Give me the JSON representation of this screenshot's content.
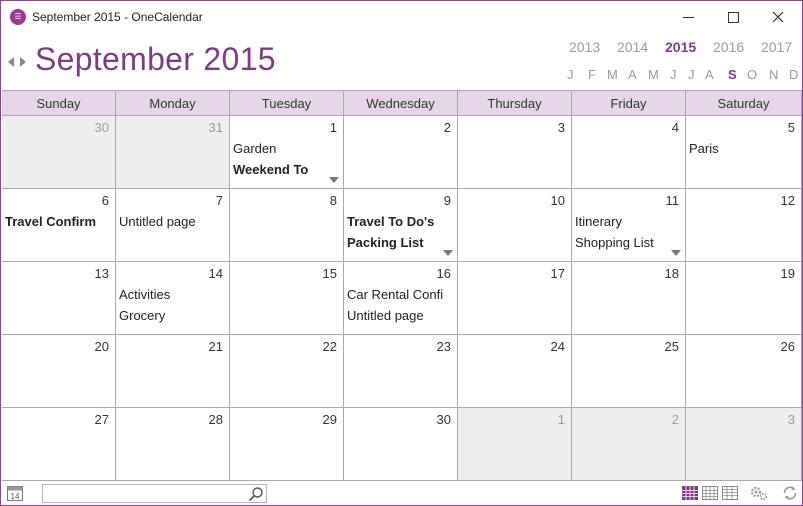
{
  "window": {
    "title": "September 2015 - OneCalendar",
    "app_icon_text": "☰"
  },
  "header": {
    "month_title": "September 2015",
    "years": [
      "2013",
      "2014",
      "2015",
      "2016",
      "2017"
    ],
    "selected_year_index": 2,
    "months": [
      "J",
      "F",
      "M",
      "A",
      "M",
      "J",
      "J",
      "A",
      "S",
      "O",
      "N",
      "D"
    ],
    "selected_month_index": 8
  },
  "weekdays": [
    "Sunday",
    "Monday",
    "Tuesday",
    "Wednesday",
    "Thursday",
    "Friday",
    "Saturday"
  ],
  "weeks": [
    [
      {
        "day": "30",
        "other": true,
        "entries": []
      },
      {
        "day": "31",
        "other": true,
        "entries": []
      },
      {
        "day": "1",
        "entries": [
          {
            "text": "Garden"
          },
          {
            "text": "Weekend To",
            "bold": true
          }
        ],
        "more": true
      },
      {
        "day": "2",
        "entries": []
      },
      {
        "day": "3",
        "entries": []
      },
      {
        "day": "4",
        "entries": []
      },
      {
        "day": "5",
        "entries": [
          {
            "text": "Paris"
          }
        ]
      }
    ],
    [
      {
        "day": "6",
        "entries": [
          {
            "text": "Travel Confirm",
            "bold": true
          }
        ]
      },
      {
        "day": "7",
        "entries": [
          {
            "text": "Untitled page"
          }
        ]
      },
      {
        "day": "8",
        "entries": []
      },
      {
        "day": "9",
        "entries": [
          {
            "text": "Travel To Do's",
            "bold": true
          },
          {
            "text": "Packing List",
            "bold": true
          }
        ],
        "more": true
      },
      {
        "day": "10",
        "entries": []
      },
      {
        "day": "11",
        "entries": [
          {
            "text": "Itinerary"
          },
          {
            "text": "Shopping List"
          }
        ],
        "more": true
      },
      {
        "day": "12",
        "entries": []
      }
    ],
    [
      {
        "day": "13",
        "entries": []
      },
      {
        "day": "14",
        "entries": [
          {
            "text": "Activities"
          },
          {
            "text": "Grocery"
          }
        ]
      },
      {
        "day": "15",
        "entries": []
      },
      {
        "day": "16",
        "entries": [
          {
            "text": "Car Rental Confi"
          },
          {
            "text": "Untitled page"
          }
        ]
      },
      {
        "day": "17",
        "entries": []
      },
      {
        "day": "18",
        "entries": []
      },
      {
        "day": "19",
        "entries": []
      }
    ],
    [
      {
        "day": "20",
        "entries": []
      },
      {
        "day": "21",
        "entries": []
      },
      {
        "day": "22",
        "entries": []
      },
      {
        "day": "23",
        "entries": []
      },
      {
        "day": "24",
        "entries": []
      },
      {
        "day": "25",
        "entries": []
      },
      {
        "day": "26",
        "entries": []
      }
    ],
    [
      {
        "day": "27",
        "entries": []
      },
      {
        "day": "28",
        "entries": []
      },
      {
        "day": "29",
        "entries": []
      },
      {
        "day": "30",
        "entries": []
      },
      {
        "day": "1",
        "other": true,
        "entries": []
      },
      {
        "day": "2",
        "other": true,
        "entries": []
      },
      {
        "day": "3",
        "other": true,
        "entries": []
      }
    ]
  ],
  "footer": {
    "today_icon_text": "14",
    "search_value": "",
    "icons": [
      "calendar-month-view-icon",
      "calendar-week-view-icon",
      "calendar-list-view-icon",
      "settings-gears-icon",
      "sync-icon"
    ]
  },
  "colors": {
    "accent": "#7d3b86",
    "border": "#9b3a96",
    "weekday_header_bg": "#e6d4e8",
    "other_month_bg": "#eeeeee"
  }
}
